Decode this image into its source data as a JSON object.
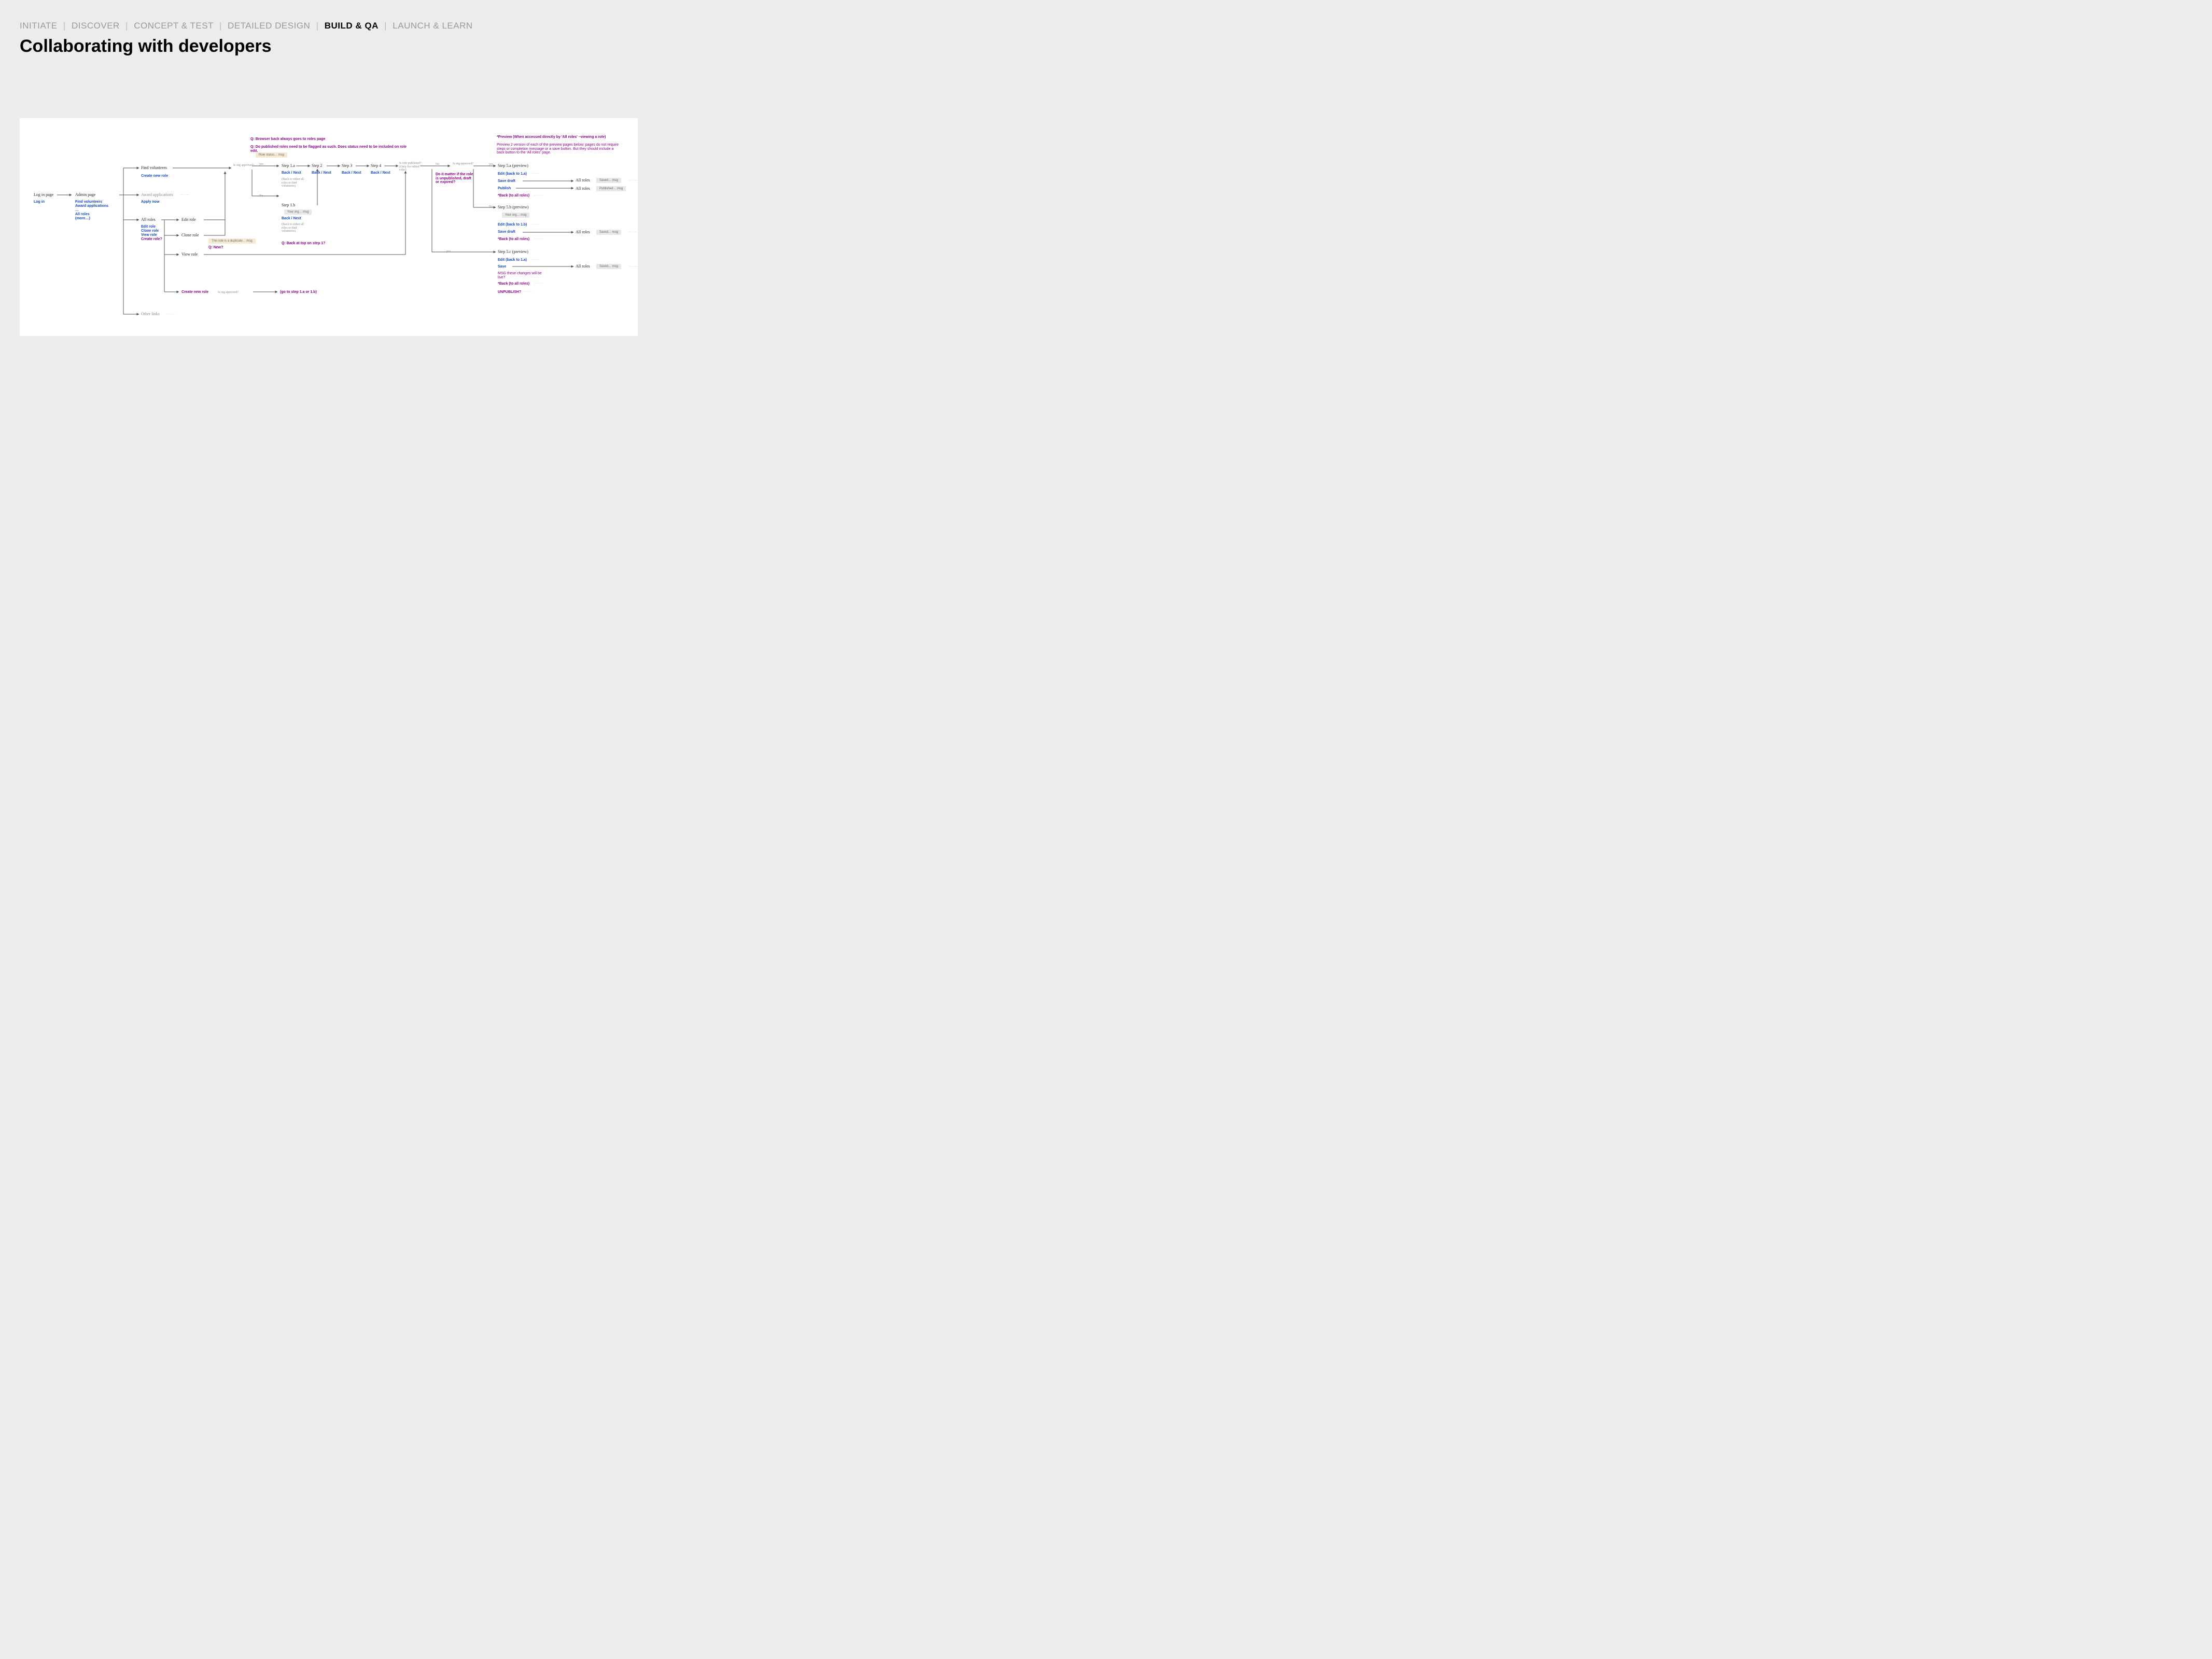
{
  "breadcrumbs": {
    "items": [
      "INITIATE",
      "DISCOVER",
      "CONCEPT & TEST",
      "DETAILED DESIGN",
      "BUILD & QA",
      "LAUNCH & LEARN"
    ],
    "active_index": 4
  },
  "title": "Collaborating with developers",
  "notes": {
    "q_browser_back": "Q: Browser back always goes to roles page",
    "q_published_flag": "Q: Do published roles need to be flagged as such. Does status need to be included on role edit.",
    "role_status_box": "Role status… msg",
    "preview_header": "*Preview (When accessed directly by 'All roles' –viewing a role)",
    "preview_body": "Preview 2 version of each of the preview pages below: pages do not require steps or completion message or a save button. But they should include a back button to the 'All roles' page.",
    "matter_if_unpub": "Do it matter if the role is unpublished, draft or expired?",
    "duplicate_box": "This role is a duplicate… msg",
    "q_new": "Q: New?",
    "q_back_top": "Q: Back at top on step 1?",
    "back_note": "(Back to either all roles or find volunteers)",
    "msg_live": "MSG these changes will be live?"
  },
  "flow": {
    "login": {
      "title": "Log in page",
      "link": "Log in"
    },
    "admin": {
      "title": "Admin page",
      "links": [
        "Find volunteers",
        "Award applications",
        "…",
        "All roles",
        "(more…)"
      ]
    },
    "find_vol": {
      "title": "Find volunteers",
      "link": "Create new role"
    },
    "award_apps": {
      "title": "Award applications",
      "link": "Apply now"
    },
    "all_roles": {
      "title": "All roles",
      "links": [
        "Edit role",
        "Clone role",
        "View role",
        "Create role?"
      ]
    },
    "edit_role": "Edit role",
    "clone_role": "Clone role",
    "view_role": "View role",
    "create_new": "Create new role",
    "create_new_suffix": "Is org approved?",
    "create_new_goto": "(go to step 1.a or 1.b)",
    "other_links": "Other links",
    "dec_org_approved": "Is org approved?",
    "dec_role_published": "Is role published? (Only for edited roles)",
    "yes": "yes",
    "no": "No",
    "steps": {
      "s1a": "Step 1.a",
      "s1b": "Step 1.b",
      "s2": "Step 2",
      "s3": "Step 3",
      "s4": "Step 4",
      "back_next": "Back / Next",
      "your_org_box": "Your org… msg"
    },
    "preview": {
      "s5a": "Step 5.a (preview)",
      "s5b": "Step 5.b (preview)",
      "s5c": "Step 5.c (preview)",
      "edit_1a": "Edit (back to 1.a)",
      "edit_1b": "Edit (back to 1.b)",
      "save_draft": "Save draft",
      "save": "Save",
      "publish": "Publish",
      "back_all": "*Back (to all roles)",
      "unpublish": "UNPUBLISH?",
      "all_roles": "All roles",
      "saved_box": "Saved… msg",
      "published_box": "Published… msg"
    }
  }
}
